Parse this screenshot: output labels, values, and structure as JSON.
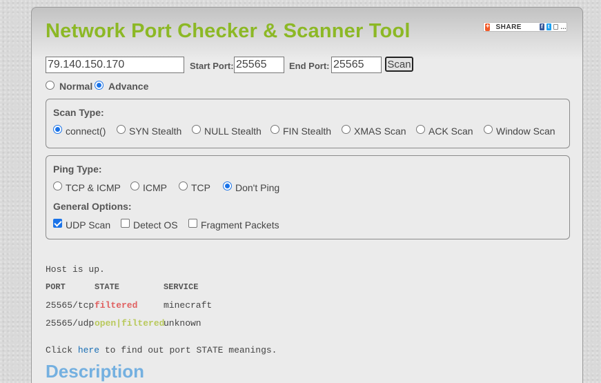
{
  "header": {
    "title": "Network Port Checker & Scanner Tool",
    "share_label": "SHARE"
  },
  "form": {
    "host_value": "79.140.150.170",
    "start_port_label": "Start Port:",
    "start_port_value": "25565",
    "end_port_label": "End Port:",
    "end_port_value": "25565",
    "scan_button": "Scan",
    "mode_options": [
      "Normal",
      "Advance"
    ],
    "mode_selected": "Advance"
  },
  "scan_type": {
    "heading": "Scan Type:",
    "options": [
      "connect()",
      "SYN Stealth",
      "NULL Stealth",
      "FIN Stealth",
      "XMAS Scan",
      "ACK Scan",
      "Window Scan"
    ],
    "selected": "connect()"
  },
  "ping_type": {
    "heading": "Ping Type:",
    "options": [
      "TCP & ICMP",
      "ICMP",
      "TCP",
      "Don't Ping"
    ],
    "selected": "Don't Ping"
  },
  "general_options": {
    "heading": "General Options:",
    "options": [
      {
        "label": "UDP Scan",
        "checked": true
      },
      {
        "label": "Detect OS",
        "checked": false
      },
      {
        "label": "Fragment Packets",
        "checked": false
      }
    ]
  },
  "results": {
    "host_status": "Host is up.",
    "columns": [
      "PORT",
      "STATE",
      "SERVICE"
    ],
    "rows": [
      {
        "port": "25565/tcp",
        "state": "filtered",
        "service": "minecraft"
      },
      {
        "port": "25565/udp",
        "state": "open|filtered",
        "service": "unknown"
      }
    ],
    "footer_prefix": "Click ",
    "footer_link": "here",
    "footer_suffix": " to find out port STATE meanings."
  },
  "description": {
    "heading": "Description"
  },
  "colors": {
    "title": "#8cb825",
    "filtered": "#e06060",
    "open_filtered": "#b9c95c",
    "link": "#1a6fb5",
    "description_heading": "#74b0e0",
    "radio_accent": "#1a73e8"
  },
  "icons": [
    "addthis-plus-icon",
    "facebook-icon",
    "twitter-icon",
    "email-icon",
    "more-icon"
  ]
}
